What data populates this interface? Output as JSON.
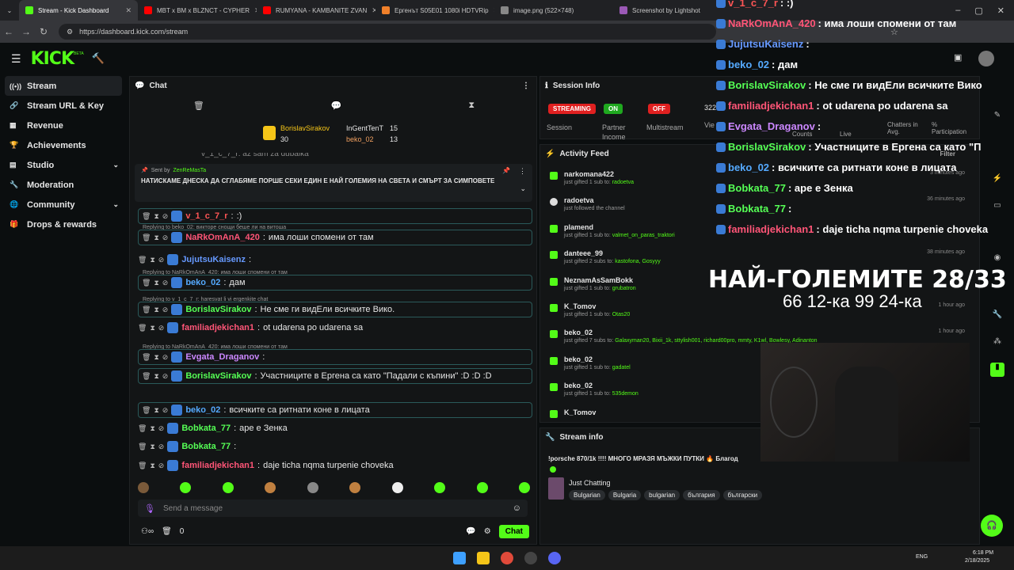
{
  "tabs": [
    {
      "label": "Stream - Kick Dashboard",
      "color": "#53fc18"
    },
    {
      "label": "MBT x BM x BLZNCT - CYPHER",
      "color": "#ff0000"
    },
    {
      "label": "RUMYANA - KAMBANITE ZVAN",
      "color": "#ff0000"
    },
    {
      "label": "Ергенът S05E01 1080i HDTVRip",
      "color": "#f0802a"
    },
    {
      "label": "image.png (522×748)",
      "color": "#888888"
    },
    {
      "label": "Screenshot by Lightshot",
      "color": "#9b59b6"
    }
  ],
  "url": "https://dashboard.kick.com/stream",
  "logo": "KICK",
  "beta": "BETA",
  "sidebar": [
    {
      "label": "Stream",
      "icon": "stream-icon"
    },
    {
      "label": "Stream URL & Key",
      "icon": "link-icon"
    },
    {
      "label": "Revenue",
      "icon": "chart-icon"
    },
    {
      "label": "Achievements",
      "icon": "trophy-icon"
    },
    {
      "label": "Studio",
      "icon": "studio-icon"
    },
    {
      "label": "Moderation",
      "icon": "wrench-icon"
    },
    {
      "label": "Community",
      "icon": "globe-icon"
    },
    {
      "label": "Drops & rewards",
      "icon": "gift-icon"
    }
  ],
  "chat": {
    "title": "Chat",
    "top": [
      {
        "name": "BorislavSirakov",
        "count": "30"
      },
      {
        "name": "InGentTenT",
        "count": "15"
      },
      {
        "name": "beko_02",
        "count": "13"
      }
    ],
    "pinned": {
      "sent_by": "Sent by",
      "user": "ZenReMasTa",
      "text": "НАТИСКАМЕ ДНЕСКА ДА СГЛАБЯМЕ ПОРШЕ СЕКИ ЕДИН Е НАЙ ГОЛЕМИЯ НА СВЕТА И СМЪРТ ЗА СИМПОВЕТЕ"
    },
    "cut_line": "v_1_c_7_r: az sam za dubaika",
    "messages": [
      {
        "user": "v_1_c_7_r",
        "color": "#ff5555",
        "text": ":)",
        "reply": ""
      },
      {
        "user": "NaRkOmAnA_420",
        "color": "#ff5577",
        "text": "има лоши спомени от там",
        "reply": "Replying to beko_02: викторе снощи беше ли на витоша"
      },
      {
        "user": "JujutsuKaisenz",
        "color": "#6699ff",
        "text": "",
        "reply": ""
      },
      {
        "user": "beko_02",
        "color": "#55aaff",
        "text": "дам",
        "reply": "Replying to NaRkOmAnA_420: има лоши спомени от там"
      },
      {
        "user": "BorislavSirakov",
        "color": "#55ff55",
        "text": "Не сме ги видЕли всичките Вико.",
        "reply": "Replying to v_1_c_7_r: haresvat li vi ergenkite chat"
      },
      {
        "user": "familiadjekichan1",
        "color": "#ff5577",
        "text": "ot udarena po udarena sa",
        "reply": ""
      },
      {
        "user": "Evgata_Draganov",
        "color": "#cc88ff",
        "text": "",
        "reply": "Replying to NaRkOmAnA_420: има лоши спомени от там"
      },
      {
        "user": "BorislavSirakov",
        "color": "#55ff55",
        "text": "Участниците в Ергена са като \"Падали с къпини\" :D :D :D",
        "reply": ""
      },
      {
        "user": "beko_02",
        "color": "#55aaff",
        "text": "всичките са ритнати коне в лицата",
        "reply": ""
      },
      {
        "user": "Bobkata_77",
        "color": "#55ff55",
        "text": "аре е Зенка",
        "reply": ""
      },
      {
        "user": "Bobkata_77",
        "color": "#55ff55",
        "text": "",
        "reply": ""
      },
      {
        "user": "familiadjekichan1",
        "color": "#ff5577",
        "text": "daje ticha nqma turpenie choveka",
        "reply": ""
      }
    ],
    "placeholder": "Send a message",
    "viewers": "0",
    "send": "Chat"
  },
  "session": {
    "title": "Session Info",
    "stats": [
      {
        "pill": "STREAMING",
        "label": "Session",
        "color": "#e02020"
      },
      {
        "pill": "ON",
        "label": "Partner Income",
        "color": "#1fa81f"
      },
      {
        "pill": "OFF",
        "label": "Multistream",
        "color": "#e02020"
      }
    ],
    "viewers_num": "322",
    "viewers_label": "Vie",
    "more": [
      "Counts",
      "Live",
      "Chatters in Avg.",
      "% Participation"
    ]
  },
  "activity": {
    "title": "Activity Feed",
    "filter": "Filter",
    "items": [
      {
        "name": "narkomana422",
        "sub": "just gifted 1 sub to:",
        "to": "radoetva",
        "time": "3 minutes ago"
      },
      {
        "name": "radoetva",
        "sub": "just followed the channel",
        "to": "",
        "time": "36 minutes ago"
      },
      {
        "name": "plamend",
        "sub": "just gifted 1 sub to:",
        "to": "valmet_on_paras_traktori",
        "time": ""
      },
      {
        "name": "danteee_99",
        "sub": "just gifted 2 subs to:",
        "to": "kastofona, Gosyyy",
        "time": "38 minutes ago"
      },
      {
        "name": "NeznamAsSamBokk",
        "sub": "just gifted 1 sub to:",
        "to": "grubatron",
        "time": ""
      },
      {
        "name": "K_Tomov",
        "sub": "just gifted 1 sub to:",
        "to": "Otas20",
        "time": "1 hour ago"
      },
      {
        "name": "beko_02",
        "sub": "just gifted 7 subs to:",
        "to": "Galaxyman20, Bixii_1k, sttylish001, richard00pro, mmty, K1wl, Bowlesy, Adinanton",
        "time": "1 hour ago"
      },
      {
        "name": "beko_02",
        "sub": "just gifted 1 sub to:",
        "to": "gadatel",
        "time": ""
      },
      {
        "name": "beko_02",
        "sub": "just gifted 1 sub to:",
        "to": "535demon",
        "time": ""
      },
      {
        "name": "K_Tomov",
        "sub": "",
        "to": "",
        "time": ""
      }
    ]
  },
  "stream_info": {
    "title": "Stream info",
    "stream_title": "!porsche 870/1k !!!! МНОГО МРАЗЯ МЪЖКИ ПУТКИ 🔥 Благод",
    "category": "Just Chatting",
    "tags": [
      "Bulgarian",
      "Bulgaria",
      "bulgarian",
      "българия",
      "български"
    ]
  },
  "overlay": {
    "lines": [
      {
        "user": "v_1_c_7_r",
        "color": "#ff5555",
        "text": ": :)"
      },
      {
        "user": "NaRkOmAnA_420",
        "color": "#ff5577",
        "text": ": има лоши спомени от там"
      },
      {
        "user": "JujutsuKaisenz",
        "color": "#6699ff",
        "text": ":"
      },
      {
        "user": "beko_02",
        "color": "#55aaff",
        "text": ": дам"
      },
      {
        "user": "BorislavSirakov",
        "color": "#55ff55",
        "text": ": Не сме ги видЕли всичките Вико"
      },
      {
        "user": "familiadjekichan1",
        "color": "#ff5577",
        "text": ": ot udarena po udarena sa"
      },
      {
        "user": "Evgata_Draganov",
        "color": "#cc88ff",
        "text": ":"
      },
      {
        "user": "BorislavSirakov",
        "color": "#55ff55",
        "text": ": Участниците в Ергена са като \"П"
      },
      {
        "user": "beko_02",
        "color": "#55aaff",
        "text": ": всичките са ритнати коне в лицата"
      },
      {
        "user": "Bobkata_77",
        "color": "#55ff55",
        "text": ": аре е Зенка"
      },
      {
        "user": "Bobkata_77",
        "color": "#55ff55",
        "text": ":"
      },
      {
        "user": "familiadjekichan1",
        "color": "#ff5577",
        "text": ": daje ticha nqma turpenie choveka"
      }
    ],
    "big_title": "НАЙ-ГОЛЕМИТЕ 28/33",
    "big_sub": "66 12-ка 99 24-ка"
  },
  "taskbar": {
    "lang": "ENG",
    "time": "6:18 PM",
    "date": "2/18/2025"
  }
}
